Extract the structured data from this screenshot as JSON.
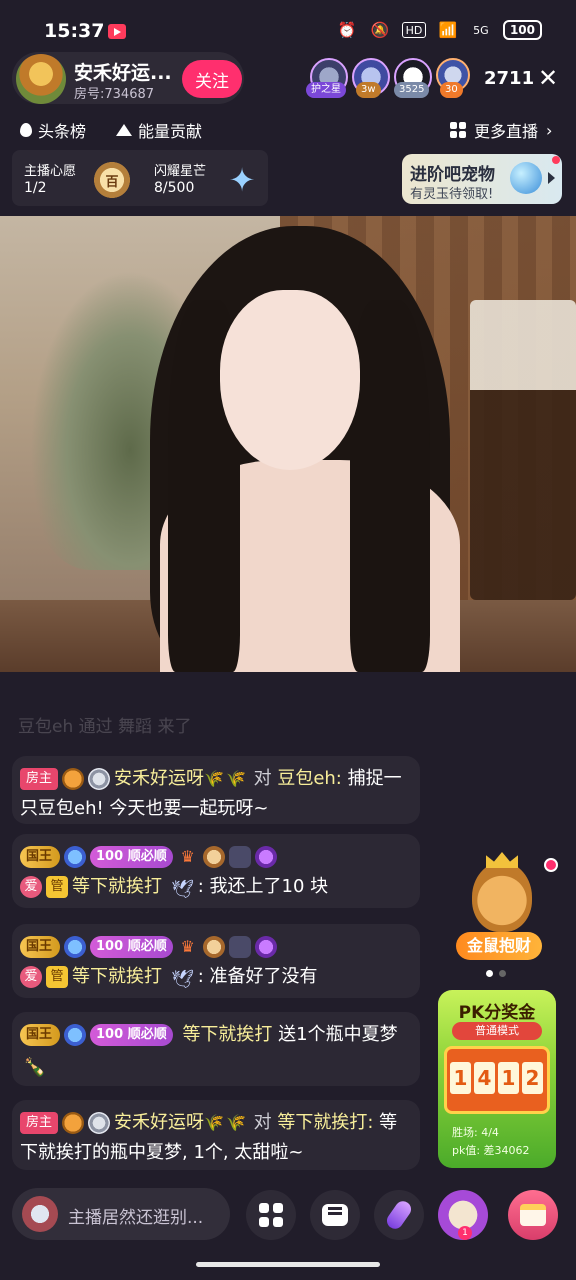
{
  "status": {
    "time": "15:37",
    "battery": "100",
    "network": "5G"
  },
  "host": {
    "name": "安禾好运...",
    "room_id": "房号:734687",
    "follow_label": "关注"
  },
  "viewers": {
    "badges": [
      "护之星",
      "3w",
      "3525",
      "30"
    ],
    "count": "2711"
  },
  "ranks": {
    "headline": "头条榜",
    "energy": "能量贡献",
    "more_live": "更多直播"
  },
  "wishes": {
    "host_wish_label": "主播心愿",
    "host_wish_count": "1/2",
    "host_wish_medal": "百",
    "star_label": "闪耀星芒",
    "star_count": "8/500"
  },
  "promo": {
    "title": "进阶吧宠物",
    "subtitle": "有灵玉待领取!"
  },
  "chat": {
    "faded": "豆包eh 通过 舞蹈 来了",
    "messages": [
      {
        "tag": "房主",
        "user": "安禾好运呀",
        "to": "对",
        "target": "豆包eh:",
        "text": "捕捉一只豆包eh! 今天也要一起玩呀~"
      },
      {
        "king": "国王",
        "level": "100",
        "fan": "顺必顺",
        "love": "爱",
        "admin": "管",
        "user": "等下就挨打",
        "text": ": 我还上了10 块"
      },
      {
        "king": "国王",
        "level": "100",
        "fan": "顺必顺",
        "love": "爱",
        "admin": "管",
        "user": "等下就挨打",
        "text": ": 准备好了没有"
      },
      {
        "king": "国王",
        "level": "100",
        "fan": "顺必顺",
        "user": "等下就挨打",
        "text": "送1个瓶中夏梦"
      },
      {
        "tag": "房主",
        "user": "安禾好运呀",
        "to": "对",
        "target": "等下就挨打:",
        "text": "等下就挨打的瓶中夏梦, 1个, 太甜啦~"
      }
    ]
  },
  "side": {
    "gold_label": "金鼠抱财",
    "pk_title": "PK分奖金",
    "pk_mode": "普通模式",
    "pk_digits": [
      "1",
      "4",
      "1",
      "2"
    ],
    "pk_win": "胜场: 4/4",
    "pk_diff": "pk值: 差34062"
  },
  "bottom": {
    "input_placeholder": "主播居然还逛别...",
    "avatar_badge": "1"
  }
}
